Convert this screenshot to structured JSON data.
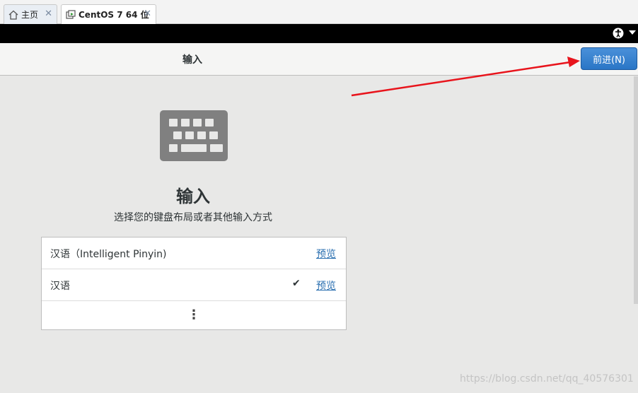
{
  "tabs": [
    {
      "label": "主页",
      "icon": "home-icon"
    },
    {
      "label": "CentOS 7 64 位",
      "icon": "vm-icon"
    }
  ],
  "header": {
    "title": "输入",
    "next_label": "前进(N)"
  },
  "content": {
    "title": "输入",
    "subtitle": "选择您的键盘布局或者其他输入方式",
    "layouts": [
      {
        "name": "汉语（Intelligent Pinyin)",
        "action": "预览",
        "selected": false
      },
      {
        "name": "汉语",
        "action": "预览",
        "selected": true
      }
    ],
    "more_label": "⋮",
    "check_symbol": "✔"
  },
  "watermark": "https://blog.csdn.net/qq_40576301",
  "colors": {
    "arrow": "#e8141c",
    "accent": "#3584e4"
  }
}
